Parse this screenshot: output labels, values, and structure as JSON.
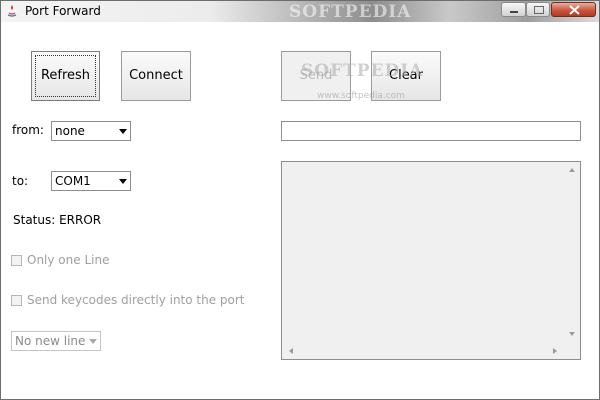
{
  "window": {
    "title": "Port Forward",
    "watermark": "SOFTPEDIA"
  },
  "buttons": {
    "refresh": "Refresh",
    "connect": "Connect",
    "send": "Send",
    "clear": "Clear"
  },
  "from": {
    "label": "from:",
    "value": "none"
  },
  "to": {
    "label": "to:",
    "value": "COM1"
  },
  "status": {
    "text": "Status: ERROR"
  },
  "options": {
    "only_one_line": "Only one Line",
    "send_keycodes": "Send keycodes directly into the port"
  },
  "newline": {
    "value": "No new line"
  },
  "input": {
    "value": ""
  },
  "overlay": {
    "watermark": "SOFTPEDIA",
    "url": "www.softpedia.com"
  }
}
